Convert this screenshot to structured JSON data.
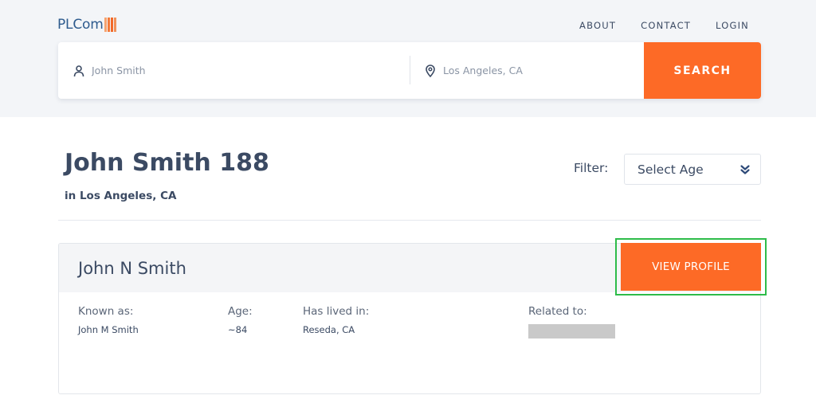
{
  "header": {
    "logo_text": "PLCom",
    "nav": [
      {
        "label": "ABOUT"
      },
      {
        "label": "CONTACT"
      },
      {
        "label": "LOGIN"
      }
    ]
  },
  "search": {
    "name_placeholder": "John Smith",
    "location_placeholder": "Los Angeles, CA",
    "button_label": "SEARCH"
  },
  "results": {
    "title": "John Smith 188",
    "subtitle": "in Los Angeles, CA",
    "filter_label": "Filter:",
    "filter_value": "Select Age"
  },
  "card": {
    "name": "John N Smith",
    "view_profile_label": "VIEW PROFILE",
    "known_as_label": "Known as:",
    "known_as_value": "John M Smith",
    "age_label": "Age:",
    "age_value": "~84",
    "lived_label": "Has lived in:",
    "lived_value": "Reseda, CA",
    "related_label": "Related to:"
  },
  "colors": {
    "accent": "#fd6a26",
    "highlight_outline": "#2ebc4a",
    "text": "#3b4a63",
    "band": "#f3f5f8"
  },
  "icons": [
    "person-icon",
    "location-pin-icon",
    "double-chevron-down-icon"
  ]
}
